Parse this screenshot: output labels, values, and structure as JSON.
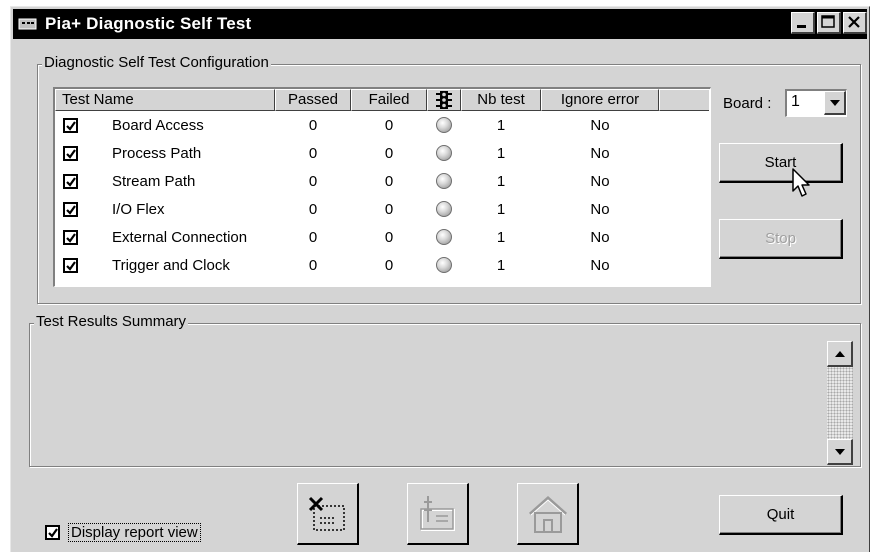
{
  "window": {
    "title": "Pia+ Diagnostic Self Test",
    "controls": [
      "minimize-icon",
      "maximize-icon",
      "close-icon"
    ]
  },
  "config": {
    "legend": "Diagnostic Self Test Configuration",
    "columns": {
      "test_name": "Test Name",
      "passed": "Passed",
      "failed": "Failed",
      "status_icon": "traffic-light-icon",
      "nb_test": "Nb test",
      "ignore_error": "Ignore error"
    },
    "rows": [
      {
        "checked": true,
        "name": "Board Access",
        "passed": "0",
        "failed": "0",
        "status": "grey",
        "nb_test": "1",
        "ignore_error": "No"
      },
      {
        "checked": true,
        "name": "Process Path",
        "passed": "0",
        "failed": "0",
        "status": "grey",
        "nb_test": "1",
        "ignore_error": "No"
      },
      {
        "checked": true,
        "name": "Stream Path",
        "passed": "0",
        "failed": "0",
        "status": "grey",
        "nb_test": "1",
        "ignore_error": "No"
      },
      {
        "checked": true,
        "name": "I/O Flex",
        "passed": "0",
        "failed": "0",
        "status": "grey",
        "nb_test": "1",
        "ignore_error": "No"
      },
      {
        "checked": true,
        "name": "External Connection",
        "passed": "0",
        "failed": "0",
        "status": "grey",
        "nb_test": "1",
        "ignore_error": "No"
      },
      {
        "checked": true,
        "name": "Trigger and Clock",
        "passed": "0",
        "failed": "0",
        "status": "grey",
        "nb_test": "1",
        "ignore_error": "No"
      }
    ],
    "board_label": "Board :",
    "board_value": "1",
    "start_label": "Start",
    "stop_label": "Stop"
  },
  "summary": {
    "legend": "Test Results Summary",
    "text": ""
  },
  "footer": {
    "display_report_label": "Display report view",
    "display_report_checked": true,
    "icon_buttons": [
      "clear-log-icon",
      "settings-icon",
      "home-icon"
    ],
    "quit_label": "Quit"
  },
  "colors": {
    "titlebar": "#000000",
    "face": "#d4d4d4",
    "led_off": "#c8c8c8"
  }
}
